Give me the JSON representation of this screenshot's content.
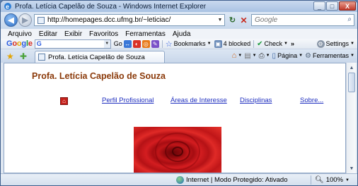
{
  "window": {
    "title": "Profa. Letícia Capelão de Souza - Windows Internet Explorer",
    "minimize_label": "_",
    "maximize_label": "□",
    "close_label": "X"
  },
  "address_bar": {
    "url": "http://homepages.dcc.ufmg.br/~leticiac/",
    "back_label": "◀",
    "forward_label": "▶",
    "refresh_label": "↻",
    "stop_label": "✕"
  },
  "search": {
    "placeholder": "Google",
    "go_label": "⌕"
  },
  "menu": {
    "items": [
      "Arquivo",
      "Editar",
      "Exibir",
      "Favoritos",
      "Ferramentas",
      "Ajuda"
    ]
  },
  "google_toolbar": {
    "logo": {
      "g": "G",
      "o1": "o",
      "o2": "o",
      "g2": "g",
      "l": "l",
      "e": "e"
    },
    "search_value": "G",
    "go_label": "Go",
    "bookmarks_label": "Bookmarks",
    "blocked_label": "4 blocked",
    "check_label": "Check",
    "more_label": "»",
    "settings_label": "Settings"
  },
  "tabs": {
    "active_tab": "Profa. Letícia Capelão de Souza"
  },
  "command_bar": {
    "page_label": "Página",
    "tools_label": "Ferramentas"
  },
  "page": {
    "title": "Profa. Letícia Capelão de Souza",
    "links": [
      "Perfil Profissional",
      "Áreas de Interesse",
      "Disciplinas",
      "Sobre..."
    ]
  },
  "status": {
    "text": "Internet | Modo Protegido: Ativado",
    "zoom": "100%"
  },
  "colors": {
    "title_color": "#8b3a0a",
    "link_color": "#1f2fbf"
  }
}
